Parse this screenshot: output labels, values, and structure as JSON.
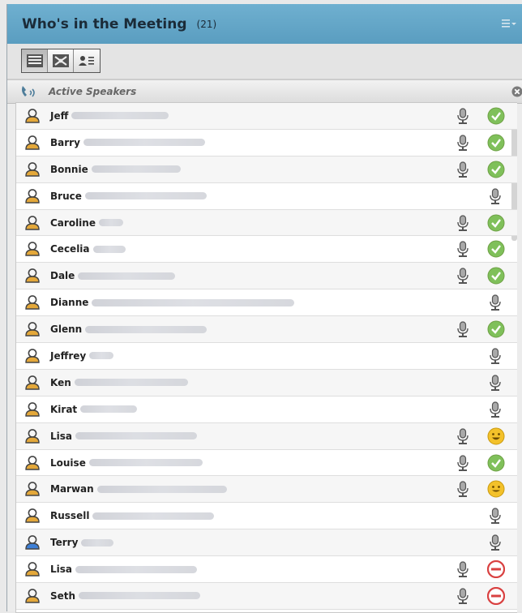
{
  "panel": {
    "title": "Who's in the Meeting",
    "count": "(21)",
    "menu_icon": "menu-icon",
    "view_buttons": [
      "list-view-icon",
      "network-view-icon",
      "attendee-card-icon"
    ]
  },
  "section": {
    "label": "Active Speakers",
    "icon": "phone-icon",
    "close_icon": "close-icon"
  },
  "colors": {
    "title_bar": "#5a9dc0",
    "status_ok": "#7fc05a",
    "status_no": "#d94141",
    "avatar_host": "#e4a83a",
    "avatar_guest": "#3d7fd6"
  },
  "attendees": [
    {
      "name": "Jeff",
      "avatar": "host",
      "mic": "speaking",
      "status": "agree"
    },
    {
      "name": "Barry",
      "avatar": "host",
      "mic": "speaking",
      "status": "agree"
    },
    {
      "name": "Bonnie",
      "avatar": "host",
      "mic": "speaking",
      "status": "agree"
    },
    {
      "name": "Bruce",
      "avatar": "host",
      "mic": "idle",
      "status": ""
    },
    {
      "name": "Caroline",
      "avatar": "host",
      "mic": "speaking",
      "status": "agree"
    },
    {
      "name": "Cecelia",
      "avatar": "host",
      "mic": "speaking",
      "status": "agree"
    },
    {
      "name": "Dale",
      "avatar": "host",
      "mic": "speaking",
      "status": "agree"
    },
    {
      "name": "Dianne",
      "avatar": "host",
      "mic": "idle",
      "status": ""
    },
    {
      "name": "Glenn",
      "avatar": "host",
      "mic": "speaking",
      "status": "agree"
    },
    {
      "name": "Jeffrey",
      "avatar": "host",
      "mic": "idle",
      "status": ""
    },
    {
      "name": "Ken",
      "avatar": "host",
      "mic": "idle",
      "status": ""
    },
    {
      "name": "Kirat",
      "avatar": "host",
      "mic": "idle",
      "status": ""
    },
    {
      "name": "Lisa",
      "avatar": "host",
      "mic": "speaking",
      "status": "laugh"
    },
    {
      "name": "Louise",
      "avatar": "host",
      "mic": "speaking",
      "status": "agree"
    },
    {
      "name": "Marwan",
      "avatar": "host",
      "mic": "speaking",
      "status": "smile"
    },
    {
      "name": "Russell",
      "avatar": "host",
      "mic": "idle",
      "status": ""
    },
    {
      "name": "Terry",
      "avatar": "guest",
      "mic": "idle",
      "status": ""
    },
    {
      "name": "Lisa",
      "avatar": "host",
      "mic": "speaking",
      "status": "disagree"
    },
    {
      "name": "Seth",
      "avatar": "host",
      "mic": "speaking",
      "status": "disagree"
    }
  ]
}
